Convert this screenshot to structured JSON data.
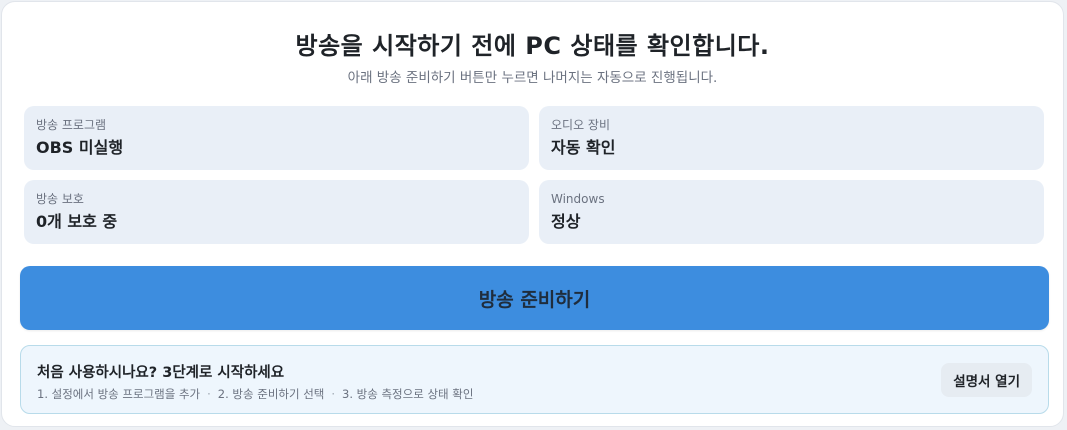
{
  "header": {
    "title": "방송을 시작하기 전에 PC 상태를 확인합니다.",
    "subtitle": "아래 방송 준비하기 버튼만 누르면 나머지는 자동으로 진행됩니다."
  },
  "status_cards": {
    "program": {
      "label": "방송 프로그램",
      "value": "OBS 미실행"
    },
    "audio": {
      "label": "오디오 장비",
      "value": "자동 확인"
    },
    "protect": {
      "label": "방송 보호",
      "value": "0개 보호 중"
    },
    "windows": {
      "label": "Windows",
      "value": "정상"
    }
  },
  "primary_button": {
    "label": "방송 준비하기"
  },
  "onboarding": {
    "title": "처음 사용하시나요? 3단계로 시작하세요",
    "steps": [
      "1. 설정에서 방송 프로그램을 추가",
      "2. 방송 준비하기 선택",
      "3. 방송 측정으로 상태 확인"
    ],
    "separator": "·",
    "guide_button": "설명서 열기"
  },
  "colors": {
    "primary": "#3d8ddf",
    "card_bg": "#e9eff7",
    "onboard_bg": "#eef6fd",
    "onboard_border": "#b8dbea"
  }
}
